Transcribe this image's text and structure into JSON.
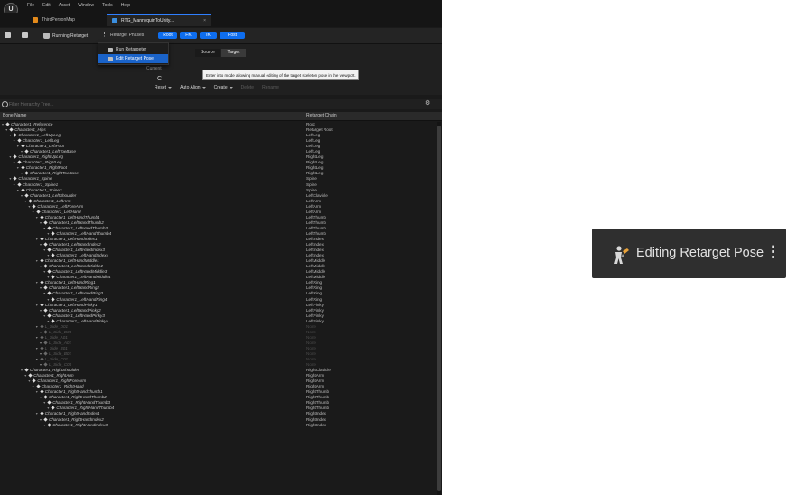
{
  "menubar": {
    "logo": "U",
    "items": [
      "File",
      "Edit",
      "Asset",
      "Window",
      "Tools",
      "Help"
    ]
  },
  "tabs": [
    {
      "label": "ThirdPersonMap",
      "color": "#e38a1b"
    },
    {
      "label": "RTG_MannyquinToUnity...",
      "color": "#3b8fe0",
      "close": "×"
    }
  ],
  "toolbar": {
    "running_label": "Running Retarget",
    "dots": "⋮",
    "phases_label": "Retarget Phases",
    "phases": [
      "Root",
      "FK",
      "IK",
      "Post"
    ]
  },
  "dropdown": {
    "items": [
      "Run Retargeter",
      "Edit Retarget Pose"
    ],
    "selected": 1
  },
  "viewport": {
    "segments": [
      "Source",
      "Target"
    ],
    "current_label": "Current",
    "tooltip": "Enter into mode allowing manual editing of the target skeleton pose in the viewport.",
    "big_letter": "C",
    "actions": [
      {
        "label": "Reset",
        "enabled": true,
        "dropdown": true
      },
      {
        "label": "Auto Align",
        "enabled": true,
        "dropdown": true
      },
      {
        "label": "Create",
        "enabled": true,
        "dropdown": true
      },
      {
        "label": "Delete",
        "enabled": false,
        "dropdown": false
      },
      {
        "label": "Rename",
        "enabled": false,
        "dropdown": false
      }
    ]
  },
  "filter": {
    "placeholder": "Filter Hierarchy Tree...",
    "gear": "⚙"
  },
  "table": {
    "headers": [
      "Bone Name",
      "Retarget Chain"
    ],
    "rows": [
      {
        "name": "Character1_Reference",
        "chain": "Root",
        "depth": 0
      },
      {
        "name": "Character1_Hips",
        "chain": "Retarget Root",
        "depth": 1
      },
      {
        "name": "Character1_LeftUpLeg",
        "chain": "LeftLeg",
        "depth": 2
      },
      {
        "name": "Character1_LeftLeg",
        "chain": "LeftLeg",
        "depth": 3
      },
      {
        "name": "Character1_LeftFoot",
        "chain": "LeftLeg",
        "depth": 4
      },
      {
        "name": "Character1_LeftToeBase",
        "chain": "LeftLeg",
        "depth": 5
      },
      {
        "name": "Character1_RightUpLeg",
        "chain": "RightLeg",
        "depth": 2
      },
      {
        "name": "Character1_RightLeg",
        "chain": "RightLeg",
        "depth": 3
      },
      {
        "name": "Character1_RightFoot",
        "chain": "RightLeg",
        "depth": 4
      },
      {
        "name": "Character1_RightToeBase",
        "chain": "RightLeg",
        "depth": 5
      },
      {
        "name": "Character1_Spine",
        "chain": "Spine",
        "depth": 2
      },
      {
        "name": "Character1_Spine1",
        "chain": "Spine",
        "depth": 3
      },
      {
        "name": "Character1_Spine2",
        "chain": "Spine",
        "depth": 4
      },
      {
        "name": "Character1_LeftShoulder",
        "chain": "LeftClavicle",
        "depth": 5
      },
      {
        "name": "Character1_LeftArm",
        "chain": "LeftArm",
        "depth": 6
      },
      {
        "name": "Character1_LeftForeArm",
        "chain": "LeftArm",
        "depth": 7
      },
      {
        "name": "Character1_LeftHand",
        "chain": "LeftArm",
        "depth": 8
      },
      {
        "name": "Character1_LeftHandThumb1",
        "chain": "LeftThumb",
        "depth": 9
      },
      {
        "name": "Character1_LeftHandThumb2",
        "chain": "LeftThumb",
        "depth": 10
      },
      {
        "name": "Character1_LeftHandThumb3",
        "chain": "LeftThumb",
        "depth": 11
      },
      {
        "name": "Character1_LeftHandThumb4",
        "chain": "LeftThumb",
        "depth": 12
      },
      {
        "name": "Character1_LeftHandIndex1",
        "chain": "LeftIndex",
        "depth": 9
      },
      {
        "name": "Character1_LeftHandIndex2",
        "chain": "LeftIndex",
        "depth": 10
      },
      {
        "name": "Character1_LeftHandIndex3",
        "chain": "LeftIndex",
        "depth": 11
      },
      {
        "name": "Character1_LeftHandIndex4",
        "chain": "LeftIndex",
        "depth": 12
      },
      {
        "name": "Character1_LeftHandMiddle1",
        "chain": "LeftMiddle",
        "depth": 9
      },
      {
        "name": "Character1_LeftHandMiddle2",
        "chain": "LeftMiddle",
        "depth": 10
      },
      {
        "name": "Character1_LeftHandMiddle3",
        "chain": "LeftMiddle",
        "depth": 11
      },
      {
        "name": "Character1_LeftHandMiddle4",
        "chain": "LeftMiddle",
        "depth": 12
      },
      {
        "name": "Character1_LeftHandRing1",
        "chain": "LeftRing",
        "depth": 9
      },
      {
        "name": "Character1_LeftHandRing2",
        "chain": "LeftRing",
        "depth": 10
      },
      {
        "name": "Character1_LeftHandRing3",
        "chain": "LeftRing",
        "depth": 11
      },
      {
        "name": "Character1_LeftHandRing4",
        "chain": "LeftRing",
        "depth": 12
      },
      {
        "name": "Character1_LeftHandPinky1",
        "chain": "LeftPinky",
        "depth": 9
      },
      {
        "name": "Character1_LeftHandPinky2",
        "chain": "LeftPinky",
        "depth": 10
      },
      {
        "name": "Character1_LeftHandPinky3",
        "chain": "LeftPinky",
        "depth": 11
      },
      {
        "name": "Character1_LeftHandPinky4",
        "chain": "LeftPinky",
        "depth": 12
      },
      {
        "name": "L_Side_D01",
        "chain": "None",
        "depth": 9,
        "dim": true
      },
      {
        "name": "L_Side_D01",
        "chain": "None",
        "depth": 10,
        "dim": true
      },
      {
        "name": "L_Side_A01",
        "chain": "None",
        "depth": 9,
        "dim": true
      },
      {
        "name": "L_Side_A01",
        "chain": "None",
        "depth": 10,
        "dim": true
      },
      {
        "name": "L_Side_B01",
        "chain": "None",
        "depth": 9,
        "dim": true
      },
      {
        "name": "L_Side_B01",
        "chain": "None",
        "depth": 10,
        "dim": true
      },
      {
        "name": "L_Side_C01",
        "chain": "None",
        "depth": 9,
        "dim": true
      },
      {
        "name": "L_Side_C01",
        "chain": "None",
        "depth": 10,
        "dim": true
      },
      {
        "name": "Character1_RightShoulder",
        "chain": "RightClavicle",
        "depth": 5
      },
      {
        "name": "Character1_RightArm",
        "chain": "RightArm",
        "depth": 6
      },
      {
        "name": "Character1_RightForeArm",
        "chain": "RightArm",
        "depth": 7
      },
      {
        "name": "Character1_RightHand",
        "chain": "RightArm",
        "depth": 8
      },
      {
        "name": "Character1_RightHandThumb1",
        "chain": "RightThumb",
        "depth": 9
      },
      {
        "name": "Character1_RightHandThumb2",
        "chain": "RightThumb",
        "depth": 10
      },
      {
        "name": "Character1_RightHandThumb3",
        "chain": "RightThumb",
        "depth": 11
      },
      {
        "name": "Character1_RightHandThumb4",
        "chain": "RightThumb",
        "depth": 12
      },
      {
        "name": "Character1_RightHandIndex1",
        "chain": "RightIndex",
        "depth": 9
      },
      {
        "name": "Character1_RightHandIndex2",
        "chain": "RightIndex",
        "depth": 10
      },
      {
        "name": "Character1_RightHandIndex3",
        "chain": "RightIndex",
        "depth": 11
      }
    ]
  },
  "pill": {
    "label": "Editing Retarget Pose",
    "dots": "⋮",
    "icon": "edit-pose-icon"
  }
}
